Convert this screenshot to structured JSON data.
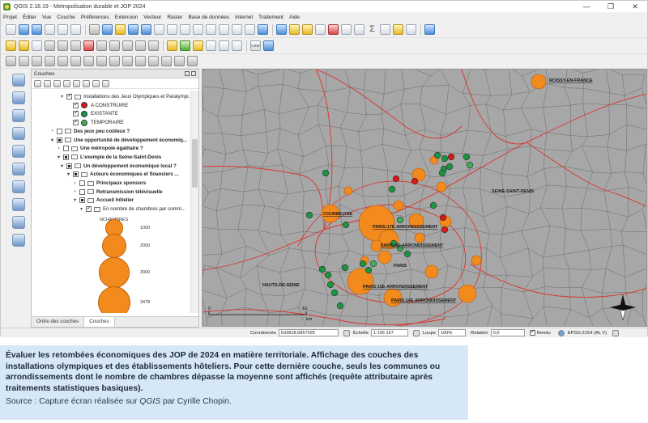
{
  "window": {
    "title": "QGIS 2.18.19 - Metropolisation durable et JOP 2024",
    "controls": [
      "—",
      "❐",
      "✕"
    ]
  },
  "menu": [
    "Projet",
    "Éditer",
    "Vue",
    "Couche",
    "Préférences",
    "Extension",
    "Vecteur",
    "Raster",
    "Base de données",
    "Internet",
    "Traitement",
    "Aide"
  ],
  "toolbar": {
    "csw_label": "CSW"
  },
  "layers_panel": {
    "title": "Couches",
    "tree": [
      {
        "text": "Installations des Jeux Olympiques et Paralympi...",
        "indent": 2,
        "check": "checked",
        "arrow": "▾",
        "icon": true,
        "bold": false
      },
      {
        "text": "A CONSTRUIRE",
        "indent": 3,
        "check": "checked",
        "symbol": "#d7191c"
      },
      {
        "text": "EXISTANTE",
        "indent": 3,
        "check": "checked",
        "symbol": "#1a9641"
      },
      {
        "text": "TEMPORAIRE",
        "indent": 3,
        "check": "checked",
        "symbol": "#3fae5a"
      },
      {
        "text": "Des jeux peu coûteux ?",
        "indent": 0,
        "check": "empty",
        "arrow": "›",
        "icon": true,
        "bold": true
      },
      {
        "text": "Une opportunité de développement économiq...",
        "indent": 0,
        "check": "partial",
        "arrow": "▾",
        "icon": true,
        "bold": true
      },
      {
        "text": "Une métropole égalitaire ?",
        "indent": 1,
        "check": "empty",
        "arrow": "›",
        "icon": true,
        "bold": true
      },
      {
        "text": "L'exemple de la Seine-Saint-Denis",
        "indent": 1,
        "check": "partial",
        "arrow": "▾",
        "icon": true,
        "bold": true
      },
      {
        "text": "Un développement économique local ?",
        "indent": 2,
        "check": "partial",
        "arrow": "▾",
        "icon": true,
        "bold": true
      },
      {
        "text": "Acteurs économiques et financiers ...",
        "indent": 3,
        "check": "partial",
        "arrow": "▾",
        "icon": true,
        "bold": true
      },
      {
        "text": "Principaux sponsors",
        "indent": 4,
        "check": "empty",
        "arrow": "›",
        "icon": true,
        "bold": true
      },
      {
        "text": "Retransmission télévisuelle",
        "indent": 4,
        "check": "empty",
        "arrow": "›",
        "icon": true,
        "bold": true
      },
      {
        "text": "Accueil hôtelier",
        "indent": 4,
        "check": "partial",
        "arrow": "▾",
        "icon": true,
        "bold": true
      },
      {
        "text": "En nombre de chambres par comm...",
        "indent": 5,
        "check": "checked",
        "arrow": "▾",
        "icon": true,
        "bold": false
      }
    ],
    "legend": {
      "title": "NCHAMBRES",
      "items": [
        {
          "label": "1000",
          "value": 1000
        },
        {
          "label": "2000",
          "value": 2000
        },
        {
          "label": "3000",
          "value": 3000
        },
        {
          "label": "3478",
          "value": 3478
        }
      ]
    },
    "tabs": [
      "Ordre des couches",
      "Couches"
    ],
    "active_tab": 1
  },
  "map": {
    "labels": {
      "seine_saint_denis": "SEINE-SAINT-DENIS",
      "hauts_de_seine": "HAUTS-DE-SEINE",
      "paris": "PARIS",
      "roissy": "ROISSY-EN-FRANCE",
      "courbevoie": "COURBEVOIE",
      "paris_17": "PARIS-17E-ARRONDISSEMENT",
      "paris_8": "PARIS-8E-ARRONDISSEMENT",
      "paris_15": "PARIS-15E-ARRONDISSEMENT",
      "paris_14": "PARIS-14E-ARRONDISSEMENT"
    },
    "scalebar": {
      "start": "0",
      "end": "10",
      "unit": "km"
    },
    "colors": {
      "background": "#a7a7a7",
      "border": "#d9342b",
      "hotel": "#f28a1e",
      "construire": "#d7191c",
      "existante": "#1a9641",
      "temporaire": "#3fae5a"
    }
  },
  "status": {
    "coord_label": "Coordonnée",
    "coord_value": "633818,6857025",
    "scale_label": "Échelle",
    "scale_value": "1:155 167",
    "magnifier_label": "Loupe",
    "magnifier_value": "100%",
    "rotation_label": "Rotation",
    "rotation_value": "0,0",
    "render_label": "Rendu",
    "crs": "EPSG:2154 (AL V)"
  },
  "caption": {
    "main": "Évaluer les retombées économiques des JOP de 2024 en matière territoriale. Affichage des couches des installations olympiques et des établissements hôteliers. Pour cette dernière couche, seuls les communes ou arrondissements dont le nombre de chambres dépasse la moyenne sont affichés (requête attributaire après traitements statistiques basiques).",
    "source_prefix": "Source : Capture écran réalisée sur ",
    "source_app": "QGIS",
    "source_suffix": " par Cyrille Chopin."
  }
}
